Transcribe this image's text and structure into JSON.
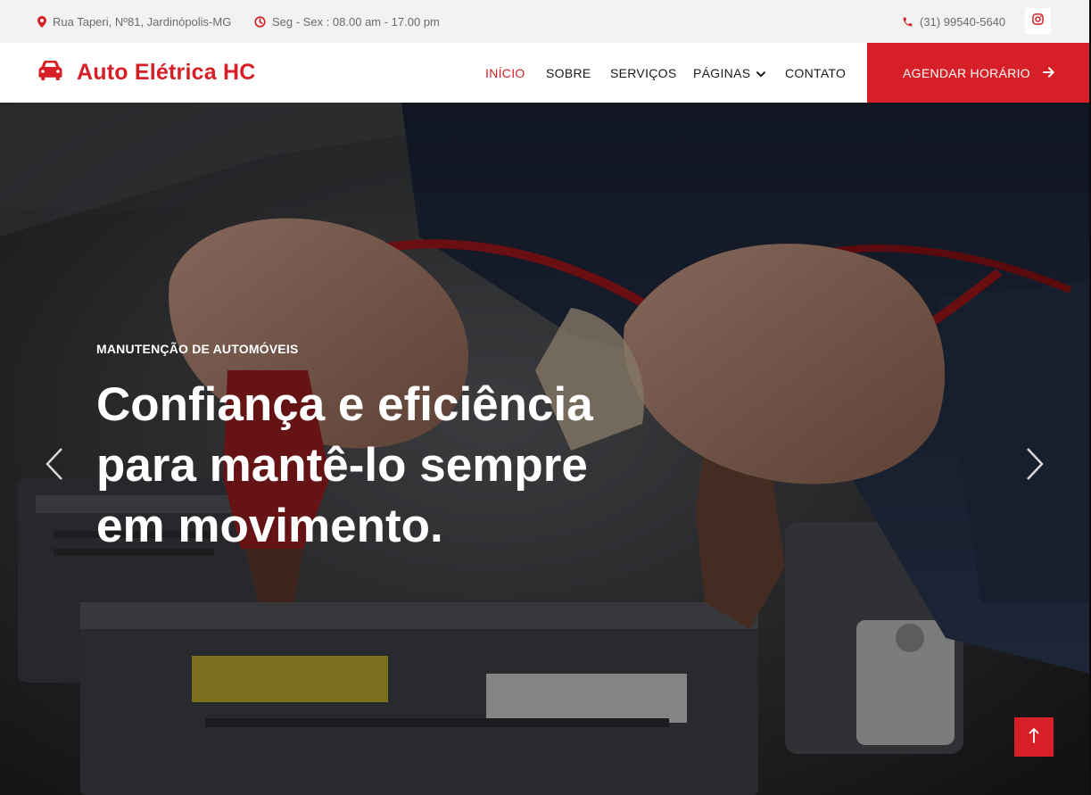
{
  "topbar": {
    "address": "Rua Taperi, Nº81, Jardinópolis-MG",
    "hours": "Seg - Sex : 08.00 am - 17.00 pm",
    "phone": "(31) 99540-5640",
    "icons": {
      "address": "map-pin-icon",
      "hours": "clock-icon",
      "phone": "phone-icon",
      "social": "instagram-icon"
    }
  },
  "navbar": {
    "logo_text": "Auto Elétrica HC",
    "logo_icon": "car-icon",
    "links": [
      {
        "label": "INÍCIO",
        "active": true
      },
      {
        "label": "SOBRE",
        "active": false
      },
      {
        "label": "SERVIÇOS",
        "active": false
      },
      {
        "label": "PÁGINAS",
        "active": false,
        "dropdown": true
      },
      {
        "label": "CONTATO",
        "active": false
      }
    ],
    "cta_label": "AGENDAR HORÁRIO"
  },
  "hero": {
    "kicker": "MANUTENÇÃO DE AUTOMÓVEIS",
    "headline_lines": [
      "Confiança e eficiência",
      "para mantê-lo sempre",
      "em movimento."
    ],
    "controls": {
      "prev": "chevron-left-icon",
      "next": "chevron-right-icon",
      "to_top": "arrow-up-icon"
    }
  },
  "colors": {
    "accent": "#d61f26",
    "topbar_bg": "#f2f2f2",
    "topbar_text": "#6b6b6b",
    "nav_text": "#1a1a1a"
  }
}
